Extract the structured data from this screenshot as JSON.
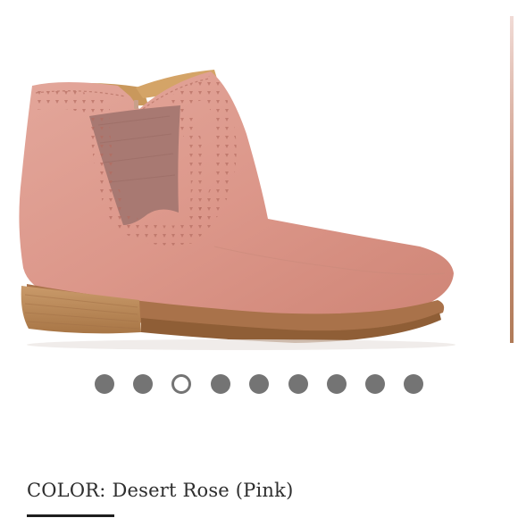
{
  "product": {
    "image_label": "Desert Rose suede ankle boot with laser-cut perforations"
  },
  "carousel": {
    "slide_count": 9,
    "active_index": 2
  },
  "color_info": {
    "label": "COLOR:",
    "value": "Desert Rose (Pink)"
  },
  "colors": {
    "dot": "#747474",
    "dot_active_fill": "#ffffff",
    "suede": "#de9a8e",
    "sole": "#bf8c5c",
    "text": "#2d2d2d"
  }
}
